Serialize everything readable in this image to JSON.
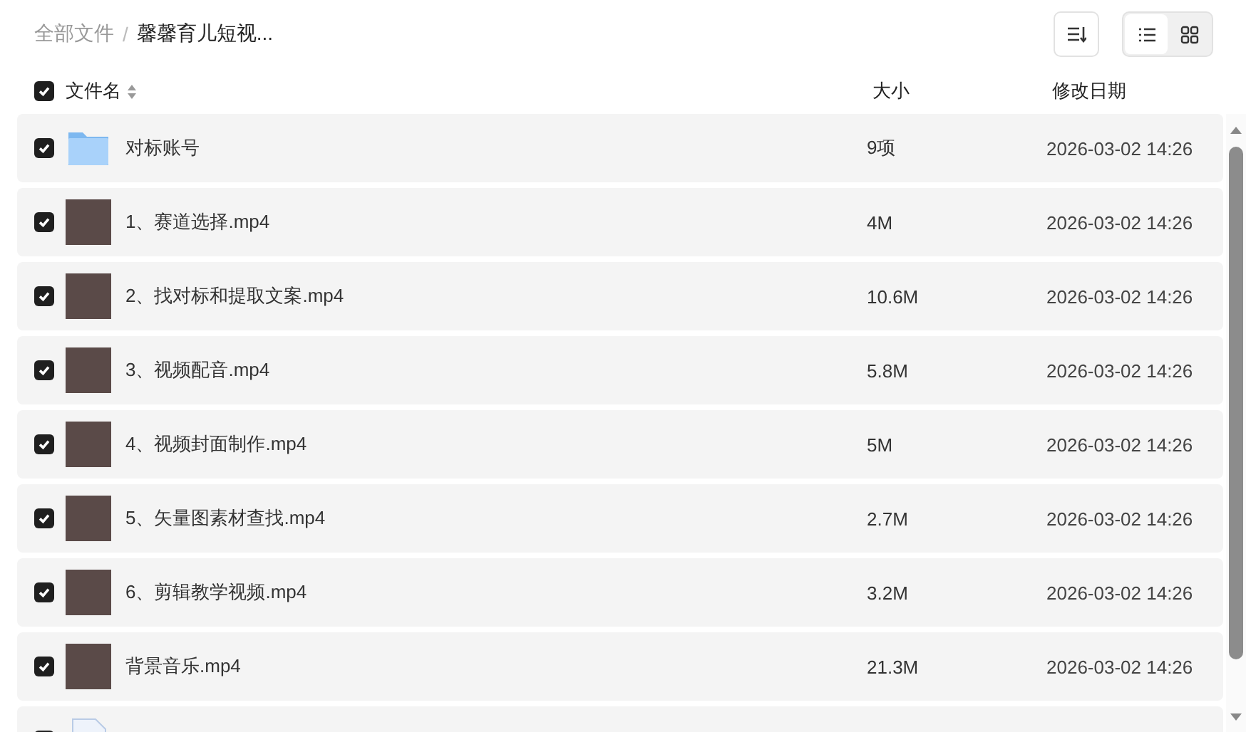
{
  "breadcrumb": {
    "items": [
      {
        "label": "全部文件",
        "current": false
      },
      {
        "label": "馨馨育儿短视...",
        "current": true
      }
    ],
    "separator": "/"
  },
  "view_toggle": [
    {
      "kind": "list",
      "selected": true
    },
    {
      "kind": "grid",
      "selected": false
    }
  ],
  "header": {
    "checked": true,
    "columns": [
      {
        "label": "文件名",
        "sortable": true
      },
      {
        "label": "大小"
      },
      {
        "label": "修改日期"
      }
    ]
  },
  "rows": [
    {
      "kind": "folder",
      "checked": true,
      "name": "对标账号",
      "size": "9项",
      "modified": "2026-03-02 14:26"
    },
    {
      "kind": "video",
      "checked": true,
      "name": "1、赛道选择.mp4",
      "size": "4M",
      "modified": "2026-03-02 14:26"
    },
    {
      "kind": "video",
      "checked": true,
      "name": "2、找对标和提取文案.mp4",
      "size": "10.6M",
      "modified": "2026-03-02 14:26"
    },
    {
      "kind": "video",
      "checked": true,
      "name": "3、视频配音.mp4",
      "size": "5.8M",
      "modified": "2026-03-02 14:26"
    },
    {
      "kind": "video",
      "checked": true,
      "name": "4、视频封面制作.mp4",
      "size": "5M",
      "modified": "2026-03-02 14:26"
    },
    {
      "kind": "video",
      "checked": true,
      "name": "5、矢量图素材查找.mp4",
      "size": "2.7M",
      "modified": "2026-03-02 14:26"
    },
    {
      "kind": "video",
      "checked": true,
      "name": "6、剪辑教学视频.mp4",
      "size": "3.2M",
      "modified": "2026-03-02 14:26"
    },
    {
      "kind": "video",
      "checked": true,
      "name": "背景音乐.mp4",
      "size": "21.3M",
      "modified": "2026-03-02 14:26"
    },
    {
      "kind": "document",
      "checked": true
    }
  ]
}
